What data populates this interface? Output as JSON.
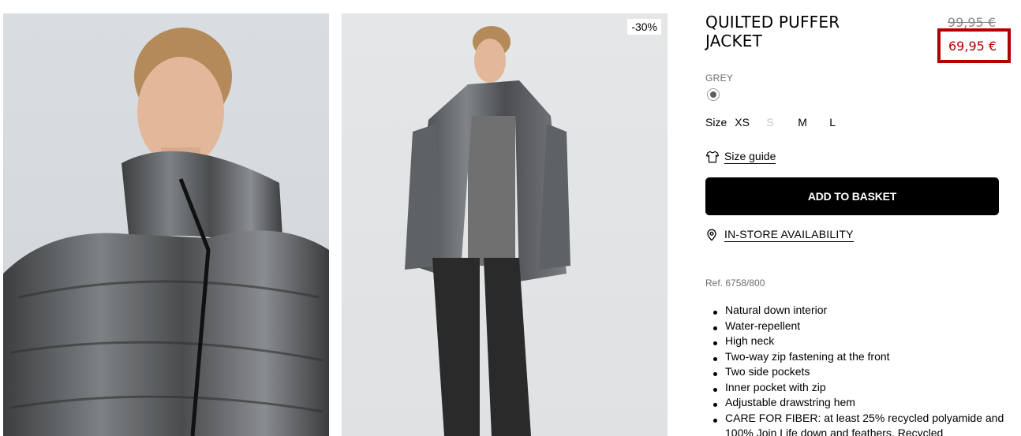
{
  "gallery": {
    "badge": "-30%"
  },
  "product": {
    "title": "QUILTED PUFFER JACKET",
    "price_old": "99,95 €",
    "price_new": "69,95 €",
    "color_label": "GREY",
    "size_label": "Size",
    "sizes": [
      {
        "label": "XS",
        "available": true
      },
      {
        "label": "S",
        "available": false
      },
      {
        "label": "M",
        "available": true
      },
      {
        "label": "L",
        "available": true
      }
    ],
    "size_guide": "Size guide",
    "add_to_basket": "ADD TO BASKET",
    "in_store": "IN-STORE AVAILABILITY",
    "ref": "Ref. 6758/800",
    "features": [
      "Natural down interior",
      "Water-repellent",
      "High neck",
      "Two-way zip fastening at the front",
      "Two side pockets",
      "Inner pocket with zip",
      "Adjustable drawstring hem",
      "CARE FOR FIBER: at least 25% recycled polyamide and 100% Join Life down and feathers. Recycled"
    ]
  },
  "colors": {
    "price_highlight": "#b00000",
    "swatch": "#5d5d5d",
    "button_bg": "#000000"
  },
  "icons": {
    "size_guide": "tshirt-icon",
    "store": "location-pin-icon"
  }
}
